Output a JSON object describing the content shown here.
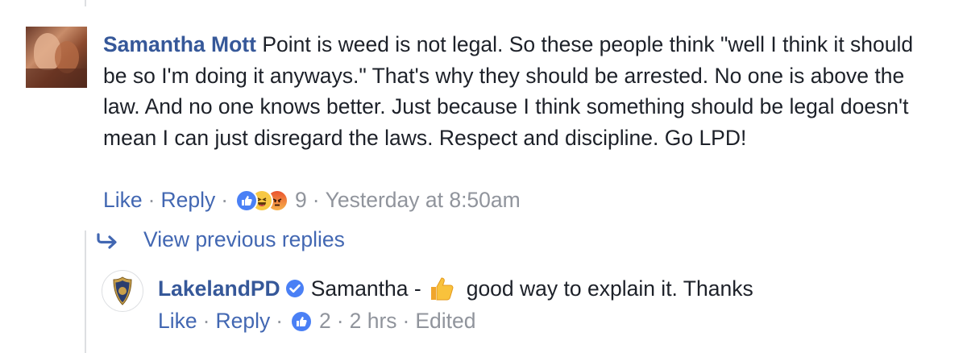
{
  "comment": {
    "author": "Samantha Mott",
    "text": "Point is weed is not legal. So these people think \"well I think it should be so I'm doing it anyways.\" That's why they should be arrested. No one is above the law. And no one knows better. Just because I think something should be legal doesn't mean I can just disregard the laws. Respect and discipline. Go LPD!",
    "like_label": "Like",
    "reply_label": "Reply",
    "reaction_icons": [
      "like-icon",
      "haha-icon",
      "angry-icon"
    ],
    "reaction_count": "9",
    "timestamp": "Yesterday at 8:50am"
  },
  "view_previous": {
    "label": "View previous replies",
    "icon": "reply-arrow-icon"
  },
  "reply": {
    "author": "LakelandPD",
    "verified_icon": "verified-badge-icon",
    "text_before": "Samantha -",
    "emoji": "thumbs-up-emoji",
    "text_after": "good way to explain it. Thanks",
    "like_label": "Like",
    "reply_label": "Reply",
    "reaction_icons": [
      "like-icon"
    ],
    "reaction_count": "2",
    "timestamp": "2 hrs",
    "edited_label": "Edited"
  },
  "colors": {
    "author_link": "#365899",
    "action_link": "#4267b2",
    "meta_gray": "#90949c",
    "like_blue": "#4a80f5"
  },
  "sep": "·"
}
